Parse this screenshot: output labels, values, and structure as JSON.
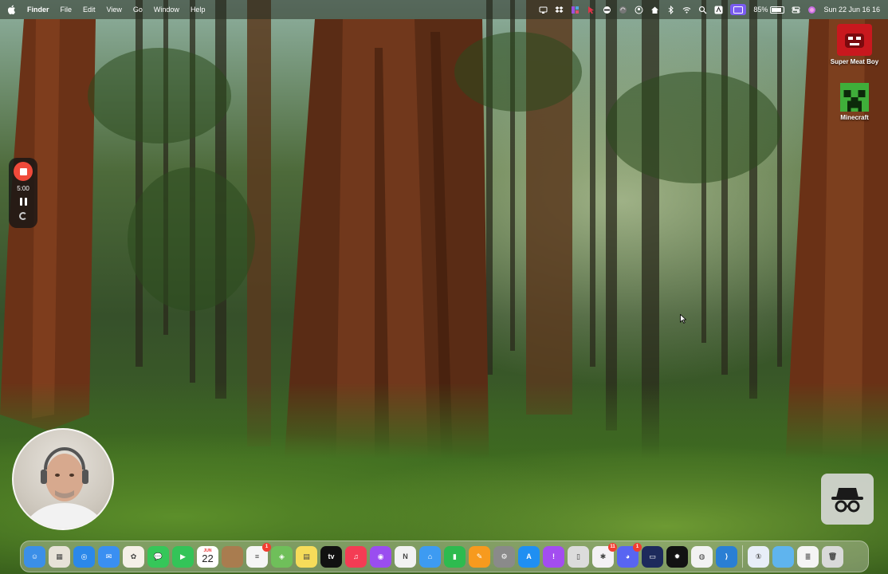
{
  "menubar": {
    "app_name": "Finder",
    "menus": [
      "File",
      "Edit",
      "View",
      "Go",
      "Window",
      "Help"
    ],
    "status_icons": [
      "screen-mirror-icon",
      "dropbox-icon",
      "grid-app-icon",
      "cursor-app-icon",
      "vpn-icon",
      "sync-icon",
      "user-icon",
      "home-icon",
      "bluetooth-icon",
      "wifi-icon",
      "search-icon",
      "text-app-icon",
      "screen-share-icon"
    ],
    "battery_percent": "85%",
    "battery_level": 0.85,
    "date_time": "Sun 22 Jun  16 16"
  },
  "desktop": {
    "icons": [
      {
        "label": "Super Meat Boy",
        "icon": "super-meat-boy-icon",
        "color": "#c8181e"
      },
      {
        "label": "Minecraft",
        "icon": "minecraft-creeper-icon",
        "color": "#3fae3a"
      }
    ]
  },
  "recording": {
    "timer": "5:00"
  },
  "dock": {
    "apps": [
      {
        "name": "Finder",
        "icon": "finder-icon",
        "color": "#3b8fe8",
        "glyph": "☺"
      },
      {
        "name": "Launchpad",
        "icon": "launchpad-icon",
        "color": "#e7e2d8",
        "glyph": "▦"
      },
      {
        "name": "Safari",
        "icon": "safari-icon",
        "color": "#2b88ea",
        "glyph": "◎"
      },
      {
        "name": "Mail",
        "icon": "mail-icon",
        "color": "#3a8ff2",
        "glyph": "✉"
      },
      {
        "name": "Photos",
        "icon": "photos-icon",
        "color": "#f5f0e8",
        "glyph": "✿"
      },
      {
        "name": "Messages",
        "icon": "messages-icon",
        "color": "#35c759",
        "glyph": "💬"
      },
      {
        "name": "FaceTime",
        "icon": "facetime-icon",
        "color": "#33c458",
        "glyph": "▶"
      },
      {
        "name": "Calendar",
        "icon": "calendar-icon",
        "color": "#ffffff",
        "month": "JUN",
        "day": "22"
      },
      {
        "name": "Notes Folder",
        "icon": "brown-folder-icon",
        "color": "#a97c4f",
        "glyph": ""
      },
      {
        "name": "Reminders",
        "icon": "reminders-icon",
        "color": "#f5f5f5",
        "glyph": "≡",
        "badge": "1"
      },
      {
        "name": "Maps",
        "icon": "maps-icon",
        "color": "#6fbf5a",
        "glyph": "◈"
      },
      {
        "name": "Notes",
        "icon": "notes-icon",
        "color": "#f6dc5a",
        "glyph": "▤"
      },
      {
        "name": "Apple TV",
        "icon": "apple-tv-icon",
        "color": "#111111",
        "glyph": "tv"
      },
      {
        "name": "Music",
        "icon": "music-icon",
        "color": "#f43c54",
        "glyph": "♫"
      },
      {
        "name": "Podcasts",
        "icon": "podcasts-icon",
        "color": "#9a4df0",
        "glyph": "◉"
      },
      {
        "name": "News",
        "icon": "news-icon",
        "color": "#f2f2f2",
        "glyph": "N"
      },
      {
        "name": "Keynote",
        "icon": "keynote-icon",
        "color": "#3d9bf2",
        "glyph": "⌂"
      },
      {
        "name": "Numbers",
        "icon": "numbers-icon",
        "color": "#2dbb4f",
        "glyph": "▮"
      },
      {
        "name": "Pages",
        "icon": "pages-icon",
        "color": "#f79a1e",
        "glyph": "✎"
      },
      {
        "name": "System Settings",
        "icon": "settings-gear-icon",
        "color": "#8a8a8a",
        "glyph": "⚙"
      },
      {
        "name": "App Store",
        "icon": "app-store-icon",
        "color": "#1f8ff2",
        "glyph": "A"
      },
      {
        "name": "Feedback",
        "icon": "feedback-icon",
        "color": "#a34df0",
        "glyph": "!"
      },
      {
        "name": "iPhone Mirroring",
        "icon": "iphone-mirroring-icon",
        "color": "#dcdcdc",
        "glyph": "▯"
      },
      {
        "name": "Slack",
        "icon": "slack-icon",
        "color": "#f4f1f4",
        "glyph": "✱",
        "badge": "11"
      },
      {
        "name": "Discord",
        "icon": "discord-icon",
        "color": "#5865f2",
        "glyph": "◕",
        "badge": "1"
      },
      {
        "name": "Screen App",
        "icon": "dark-blue-app-icon",
        "color": "#1d2a5c",
        "glyph": "▭"
      },
      {
        "name": "Gear App",
        "icon": "yellow-gear-icon",
        "color": "#121212",
        "glyph": "✹"
      },
      {
        "name": "Chrome",
        "icon": "chrome-icon",
        "color": "#f2f2f2",
        "glyph": "◍"
      },
      {
        "name": "VS Code",
        "icon": "vscode-icon",
        "color": "#2a7fd4",
        "glyph": "⟩"
      }
    ],
    "right_items": [
      {
        "name": "1Password",
        "icon": "onepassword-icon",
        "color": "#e8eef8",
        "glyph": "①"
      },
      {
        "name": "Folder",
        "icon": "folder-icon",
        "color": "#5fb4ee",
        "glyph": ""
      },
      {
        "name": "Documents Stack",
        "icon": "documents-stack-icon",
        "color": "#f4f4f4",
        "glyph": "≣"
      },
      {
        "name": "Trash",
        "icon": "trash-icon",
        "color": "#d9d9d9",
        "glyph": "🗑"
      }
    ]
  }
}
